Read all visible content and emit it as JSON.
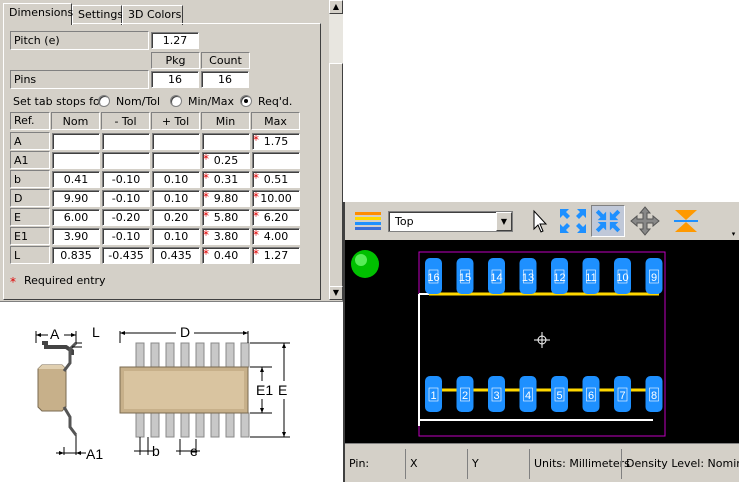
{
  "tabs": [
    "Dimensions",
    "Settings",
    "3D Colors"
  ],
  "pitch": {
    "label": "Pitch (e)",
    "value": "1.27"
  },
  "pins": {
    "label": "Pins",
    "pkg_header": "Pkg",
    "count_header": "Count",
    "pkg": "16",
    "count": "16"
  },
  "tabstops": {
    "label": "Set tab stops for:",
    "options": [
      "Nom/Tol",
      "Min/Max",
      "Req'd."
    ],
    "selected": 2
  },
  "table": {
    "headers": [
      "Ref.",
      "Nom",
      "- Tol",
      "+ Tol",
      "Min",
      "Max"
    ],
    "rows": [
      {
        "ref": "A",
        "nom": "",
        "mtol": "",
        "ptol": "",
        "min": "",
        "max": "1.75",
        "min_req": false,
        "max_req": true
      },
      {
        "ref": "A1",
        "nom": "",
        "mtol": "",
        "ptol": "",
        "min": "0.25",
        "max": "",
        "min_req": true,
        "max_req": false
      },
      {
        "ref": "b",
        "nom": "0.41",
        "mtol": "-0.10",
        "ptol": "0.10",
        "min": "0.31",
        "max": "0.51",
        "min_req": true,
        "max_req": true
      },
      {
        "ref": "D",
        "nom": "9.90",
        "mtol": "-0.10",
        "ptol": "0.10",
        "min": "9.80",
        "max": "10.00",
        "min_req": true,
        "max_req": true
      },
      {
        "ref": "E",
        "nom": "6.00",
        "mtol": "-0.20",
        "ptol": "0.20",
        "min": "5.80",
        "max": "6.20",
        "min_req": true,
        "max_req": true
      },
      {
        "ref": "E1",
        "nom": "3.90",
        "mtol": "-0.10",
        "ptol": "0.10",
        "min": "3.80",
        "max": "4.00",
        "min_req": true,
        "max_req": true
      },
      {
        "ref": "L",
        "nom": "0.835",
        "mtol": "-0.435",
        "ptol": "0.435",
        "min": "0.40",
        "max": "1.27",
        "min_req": true,
        "max_req": true
      }
    ]
  },
  "required_note": "Required entry",
  "required_mark": "*",
  "drawing_labels": {
    "A": "A",
    "L": "L",
    "A1": "A1",
    "D": "D",
    "E1": "E1",
    "E": "E",
    "b": "b",
    "e": "e"
  },
  "viewer": {
    "layer": "Top",
    "tools": [
      "layers-icon",
      "pointer-icon",
      "zoom-extents-icon",
      "zoom-fit-icon",
      "pan-icon",
      "flip-icon"
    ],
    "pins_top": [
      "16",
      "15",
      "14",
      "13",
      "12",
      "11",
      "10",
      "9"
    ],
    "pins_bottom": [
      "1",
      "2",
      "3",
      "4",
      "5",
      "6",
      "7",
      "8"
    ],
    "status": {
      "pin": "Pin:",
      "x": "X",
      "y": "Y",
      "units": "Units: Millimeters",
      "density": "Density Level: Nominal"
    }
  },
  "colors": {
    "pad": "#1e90ff",
    "silk": "#ffd700",
    "courtyard": "#c000c0",
    "indicator": "#00d000",
    "panel": "#d4d0c8"
  }
}
